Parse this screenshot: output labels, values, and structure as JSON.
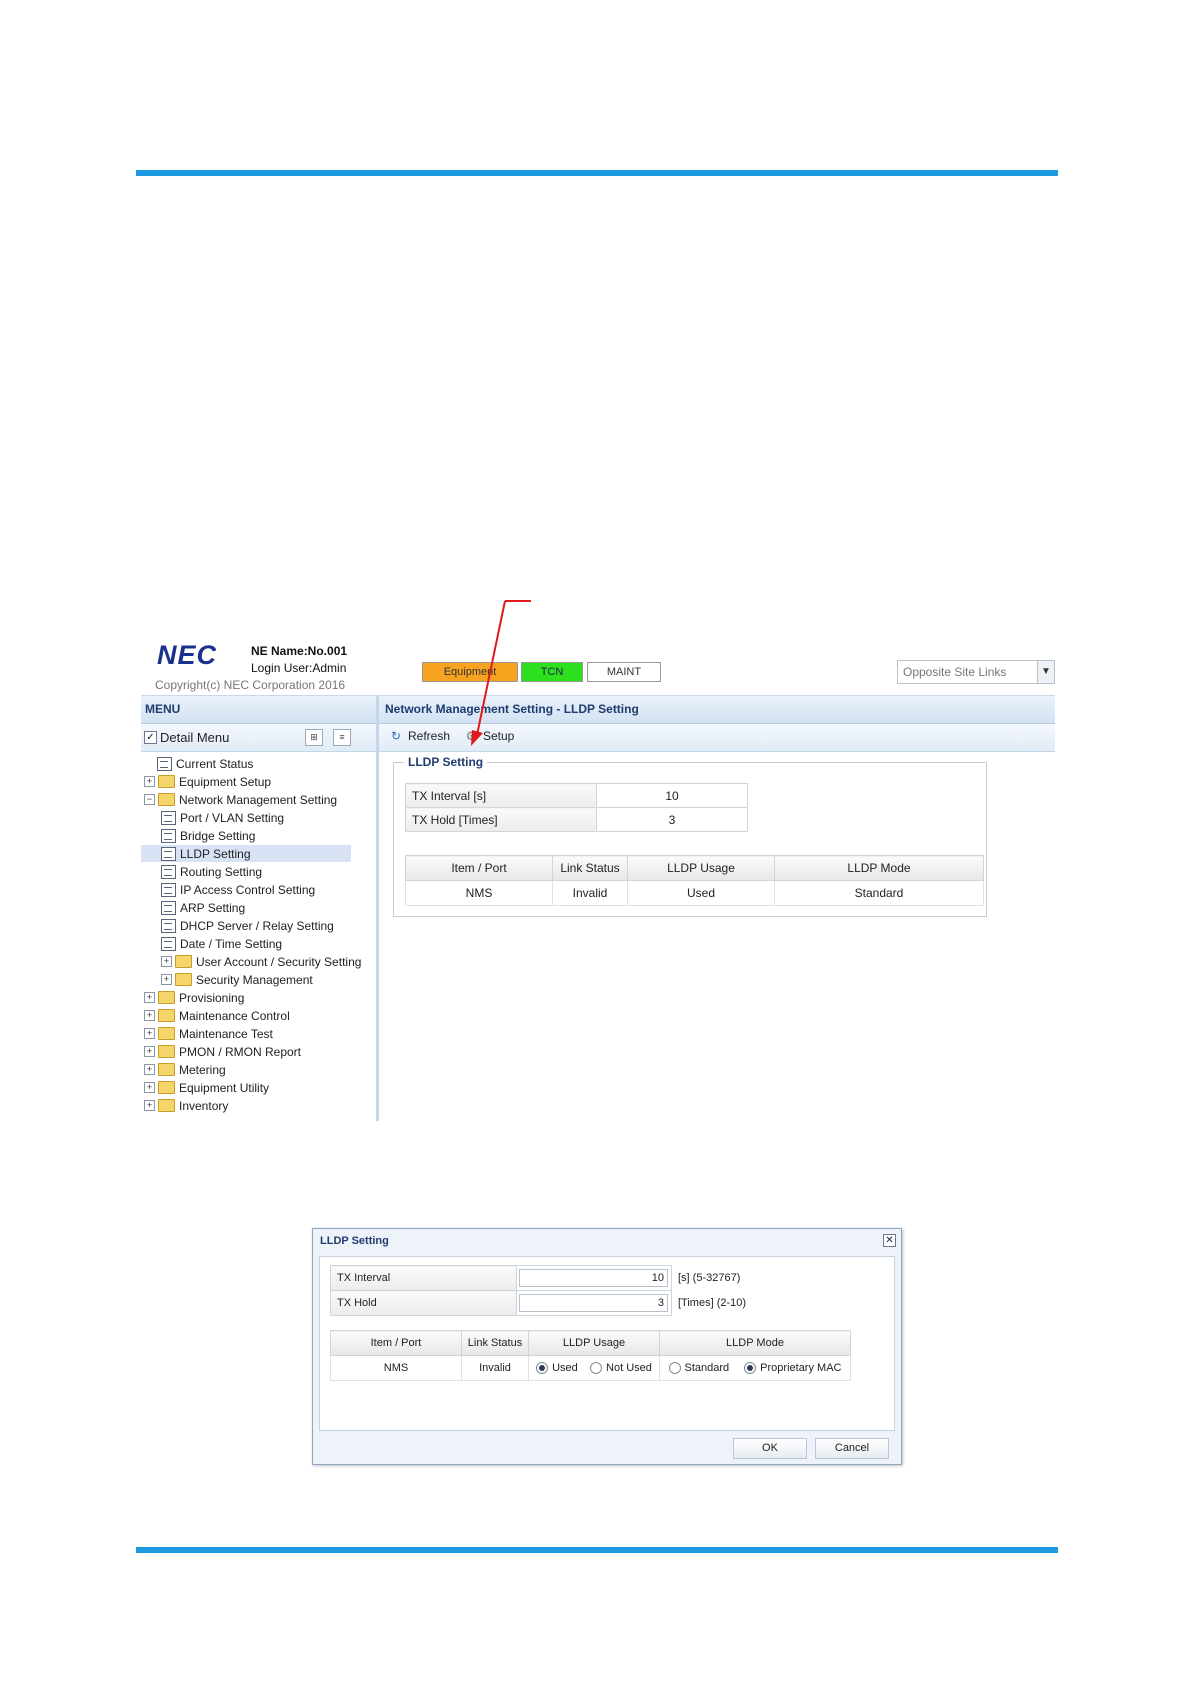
{
  "header": {
    "logo": "NEC",
    "ne_name": "NE Name:No.001",
    "login_user": "Login User:Admin",
    "copyright": "Copyright(c) NEC Corporation 2016",
    "status": {
      "equipment": "Equipment",
      "tcn": "TCN",
      "maint": "MAINT"
    },
    "site_links_placeholder": "Opposite Site Links"
  },
  "menu": {
    "title": "MENU",
    "detail_menu_label": "Detail Menu",
    "items": [
      {
        "label": "Current Status",
        "kind": "page"
      },
      {
        "label": "Equipment Setup",
        "kind": "folder"
      },
      {
        "label": "Network Management Setting",
        "kind": "folder-open"
      },
      {
        "label": "Port / VLAN Setting",
        "kind": "page"
      },
      {
        "label": "Bridge Setting",
        "kind": "page"
      },
      {
        "label": "LLDP Setting",
        "kind": "page",
        "selected": true
      },
      {
        "label": "Routing Setting",
        "kind": "page"
      },
      {
        "label": "IP Access Control Setting",
        "kind": "page"
      },
      {
        "label": "ARP Setting",
        "kind": "page"
      },
      {
        "label": "DHCP Server / Relay Setting",
        "kind": "page"
      },
      {
        "label": "Date / Time Setting",
        "kind": "page"
      },
      {
        "label": "User Account / Security Setting",
        "kind": "folder"
      },
      {
        "label": "Security Management",
        "kind": "folder"
      },
      {
        "label": "Provisioning",
        "kind": "folder"
      },
      {
        "label": "Maintenance Control",
        "kind": "folder"
      },
      {
        "label": "Maintenance Test",
        "kind": "folder"
      },
      {
        "label": "PMON / RMON Report",
        "kind": "folder"
      },
      {
        "label": "Metering",
        "kind": "folder"
      },
      {
        "label": "Equipment Utility",
        "kind": "folder"
      },
      {
        "label": "Inventory",
        "kind": "folder"
      }
    ]
  },
  "content": {
    "title": "Network Management Setting - LLDP Setting",
    "toolbar": {
      "refresh": "Refresh",
      "setup": "Setup"
    },
    "section_title": "LLDP Setting",
    "params": [
      {
        "label": "TX Interval [s]",
        "value": "10"
      },
      {
        "label": "TX Hold [Times]",
        "value": "3"
      }
    ],
    "port_headers": [
      "Item / Port",
      "Link Status",
      "LLDP Usage",
      "LLDP Mode"
    ],
    "port_rows": [
      [
        "NMS",
        "Invalid",
        "Used",
        "Standard"
      ]
    ]
  },
  "dialog": {
    "title": "LLDP Setting",
    "tx_interval_label": "TX Interval",
    "tx_interval_value": "10",
    "tx_interval_range": "[s] (5-32767)",
    "tx_hold_label": "TX Hold",
    "tx_hold_value": "3",
    "tx_hold_range": "[Times] (2-10)",
    "port_headers": [
      "Item / Port",
      "Link Status",
      "LLDP Usage",
      "LLDP Mode"
    ],
    "port_item": "NMS",
    "port_link_status": "Invalid",
    "usage_options": [
      "Used",
      "Not Used"
    ],
    "usage_selected": "Used",
    "mode_options": [
      "Standard",
      "Proprietary MAC"
    ],
    "mode_selected": "Proprietary MAC",
    "ok_label": "OK",
    "cancel_label": "Cancel"
  },
  "colors": {
    "rule": "#1e9ae0",
    "arrow": "#e01b1b",
    "equipment_status": "#f7a320",
    "tcn_status": "#2fe01f"
  }
}
